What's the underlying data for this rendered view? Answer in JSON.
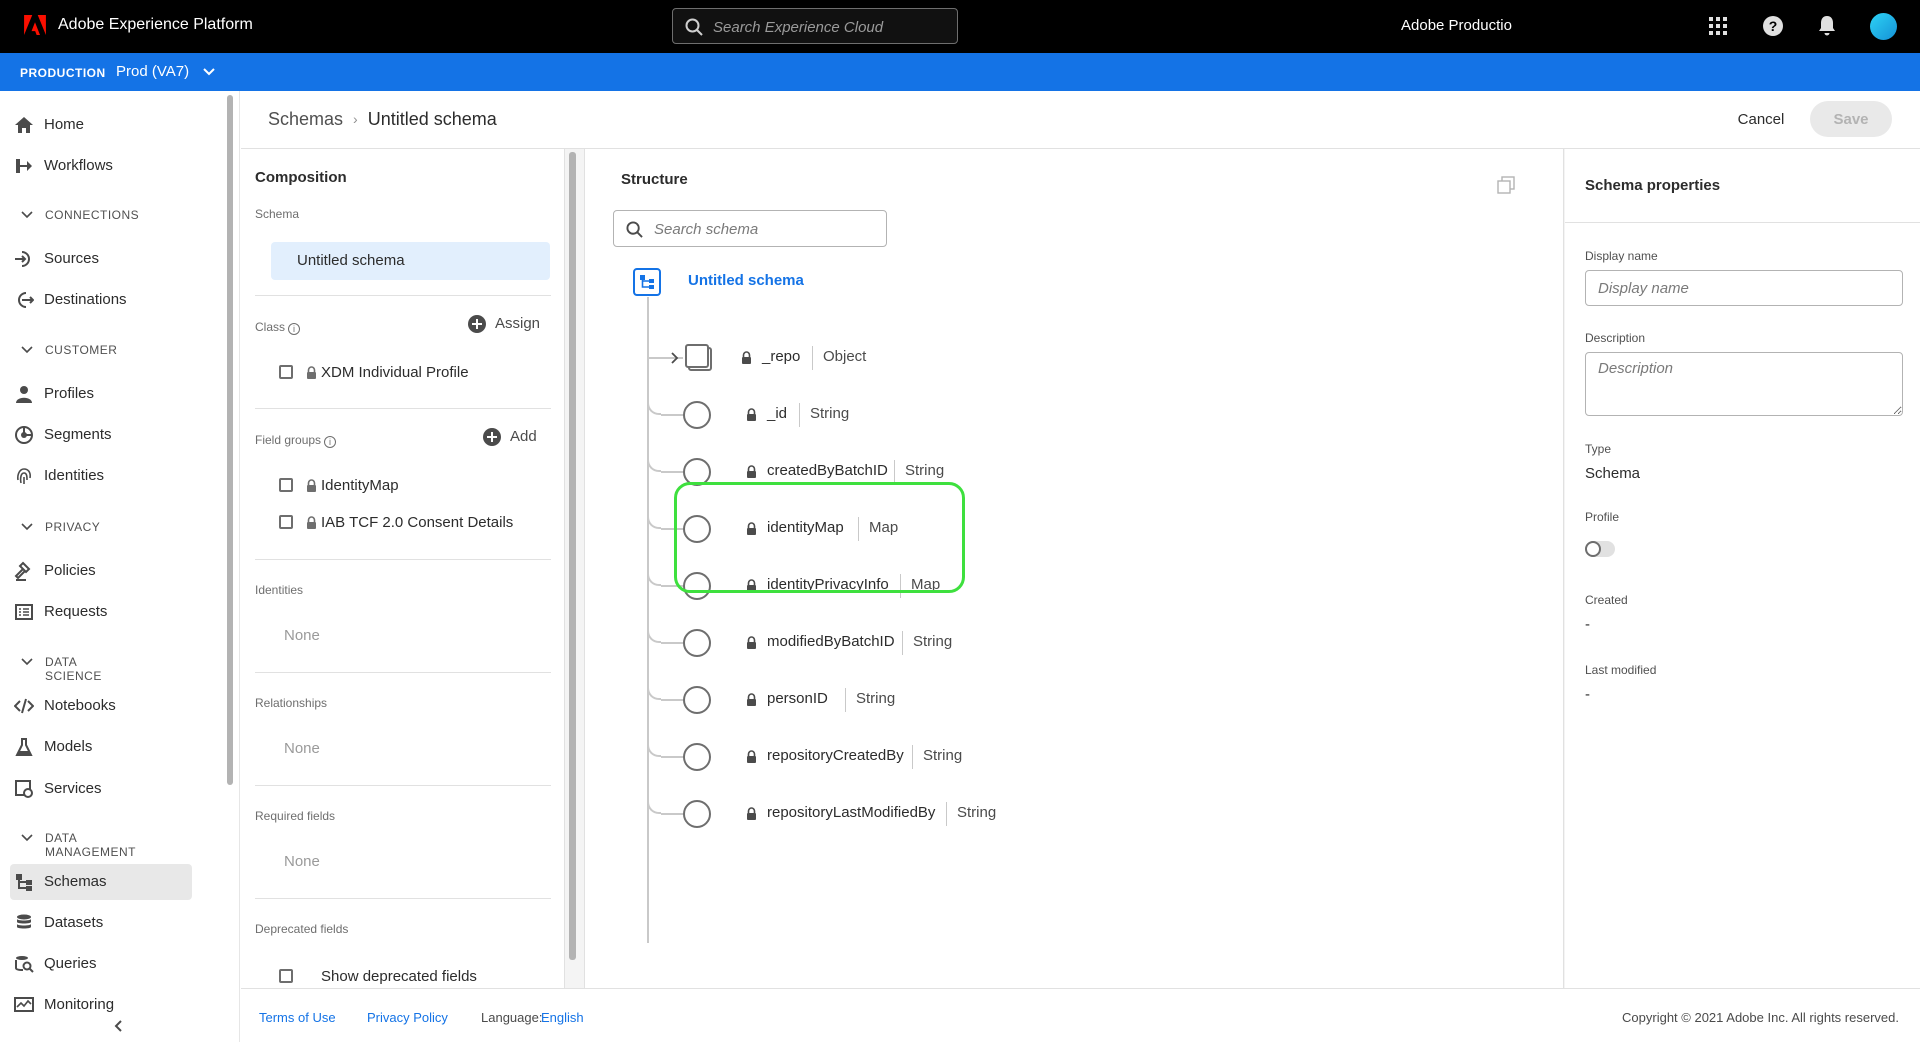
{
  "topbar": {
    "app_title": "Adobe Experience Platform",
    "search_placeholder": "Search Experience Cloud",
    "org_name": "Adobe Productio",
    "icons": [
      "adobe-logo-icon",
      "search-icon",
      "app-switcher-icon",
      "help-icon",
      "notifications-bell-icon",
      "user-avatar"
    ]
  },
  "envbar": {
    "label": "PRODUCTION",
    "sandbox": "Prod (VA7)"
  },
  "nav": {
    "items": {
      "home": "Home",
      "workflows": "Workflows",
      "sources": "Sources",
      "destinations": "Destinations",
      "profiles": "Profiles",
      "segments": "Segments",
      "identities": "Identities",
      "policies": "Policies",
      "requests": "Requests",
      "notebooks": "Notebooks",
      "models": "Models",
      "services": "Services",
      "schemas": "Schemas",
      "datasets": "Datasets",
      "queries": "Queries",
      "monitoring": "Monitoring"
    },
    "sections": {
      "connections": "CONNECTIONS",
      "customer": "CUSTOMER",
      "privacy": "PRIVACY",
      "data_science": "DATA SCIENCE",
      "data_management": "DATA MANAGEMENT"
    },
    "active": "Schemas"
  },
  "breadcrumb": {
    "parent": "Schemas",
    "current": "Untitled schema"
  },
  "actions": {
    "cancel": "Cancel",
    "save": "Save"
  },
  "composition": {
    "title": "Composition",
    "schema_label": "Schema",
    "schema_name": "Untitled schema",
    "class_label": "Class",
    "assign_label": "Assign",
    "class_item": "XDM Individual Profile",
    "field_groups_label": "Field groups",
    "add_label": "Add",
    "field_groups": [
      "IdentityMap",
      "IAB TCF 2.0 Consent Details"
    ],
    "identities_label": "Identities",
    "identities_value": "None",
    "relationships_label": "Relationships",
    "relationships_value": "None",
    "required_label": "Required fields",
    "required_value": "None",
    "deprecated_label": "Deprecated fields",
    "show_deprecated": "Show deprecated fields"
  },
  "structure": {
    "title": "Structure",
    "search_placeholder": "Search schema",
    "root": "Untitled schema",
    "fields": [
      {
        "name": "_repo",
        "type": "Object"
      },
      {
        "name": "_id",
        "type": "String"
      },
      {
        "name": "createdByBatchID",
        "type": "String"
      },
      {
        "name": "identityMap",
        "type": "Map"
      },
      {
        "name": "identityPrivacyInfo",
        "type": "Map"
      },
      {
        "name": "modifiedByBatchID",
        "type": "String"
      },
      {
        "name": "personID",
        "type": "String"
      },
      {
        "name": "repositoryCreatedBy",
        "type": "String"
      },
      {
        "name": "repositoryLastModifiedBy",
        "type": "String"
      }
    ],
    "highlight_color": "#3ee03e"
  },
  "properties": {
    "title": "Schema properties",
    "display_name_label": "Display name",
    "display_name_placeholder": "Display name",
    "description_label": "Description",
    "description_placeholder": "Description",
    "type_label": "Type",
    "type_value": "Schema",
    "profile_label": "Profile",
    "profile_enabled": false,
    "created_label": "Created",
    "created_value": "-",
    "modified_label": "Last modified",
    "modified_value": "-"
  },
  "footer": {
    "terms": "Terms of Use",
    "privacy": "Privacy Policy",
    "language_label": "Language:",
    "language_value": "English",
    "copyright": "Copyright ©  2021 Adobe Inc.  All rights reserved."
  },
  "colors": {
    "accent": "#1473e6",
    "topbar_bg": "#000000",
    "envbar_bg": "#1473e6"
  }
}
